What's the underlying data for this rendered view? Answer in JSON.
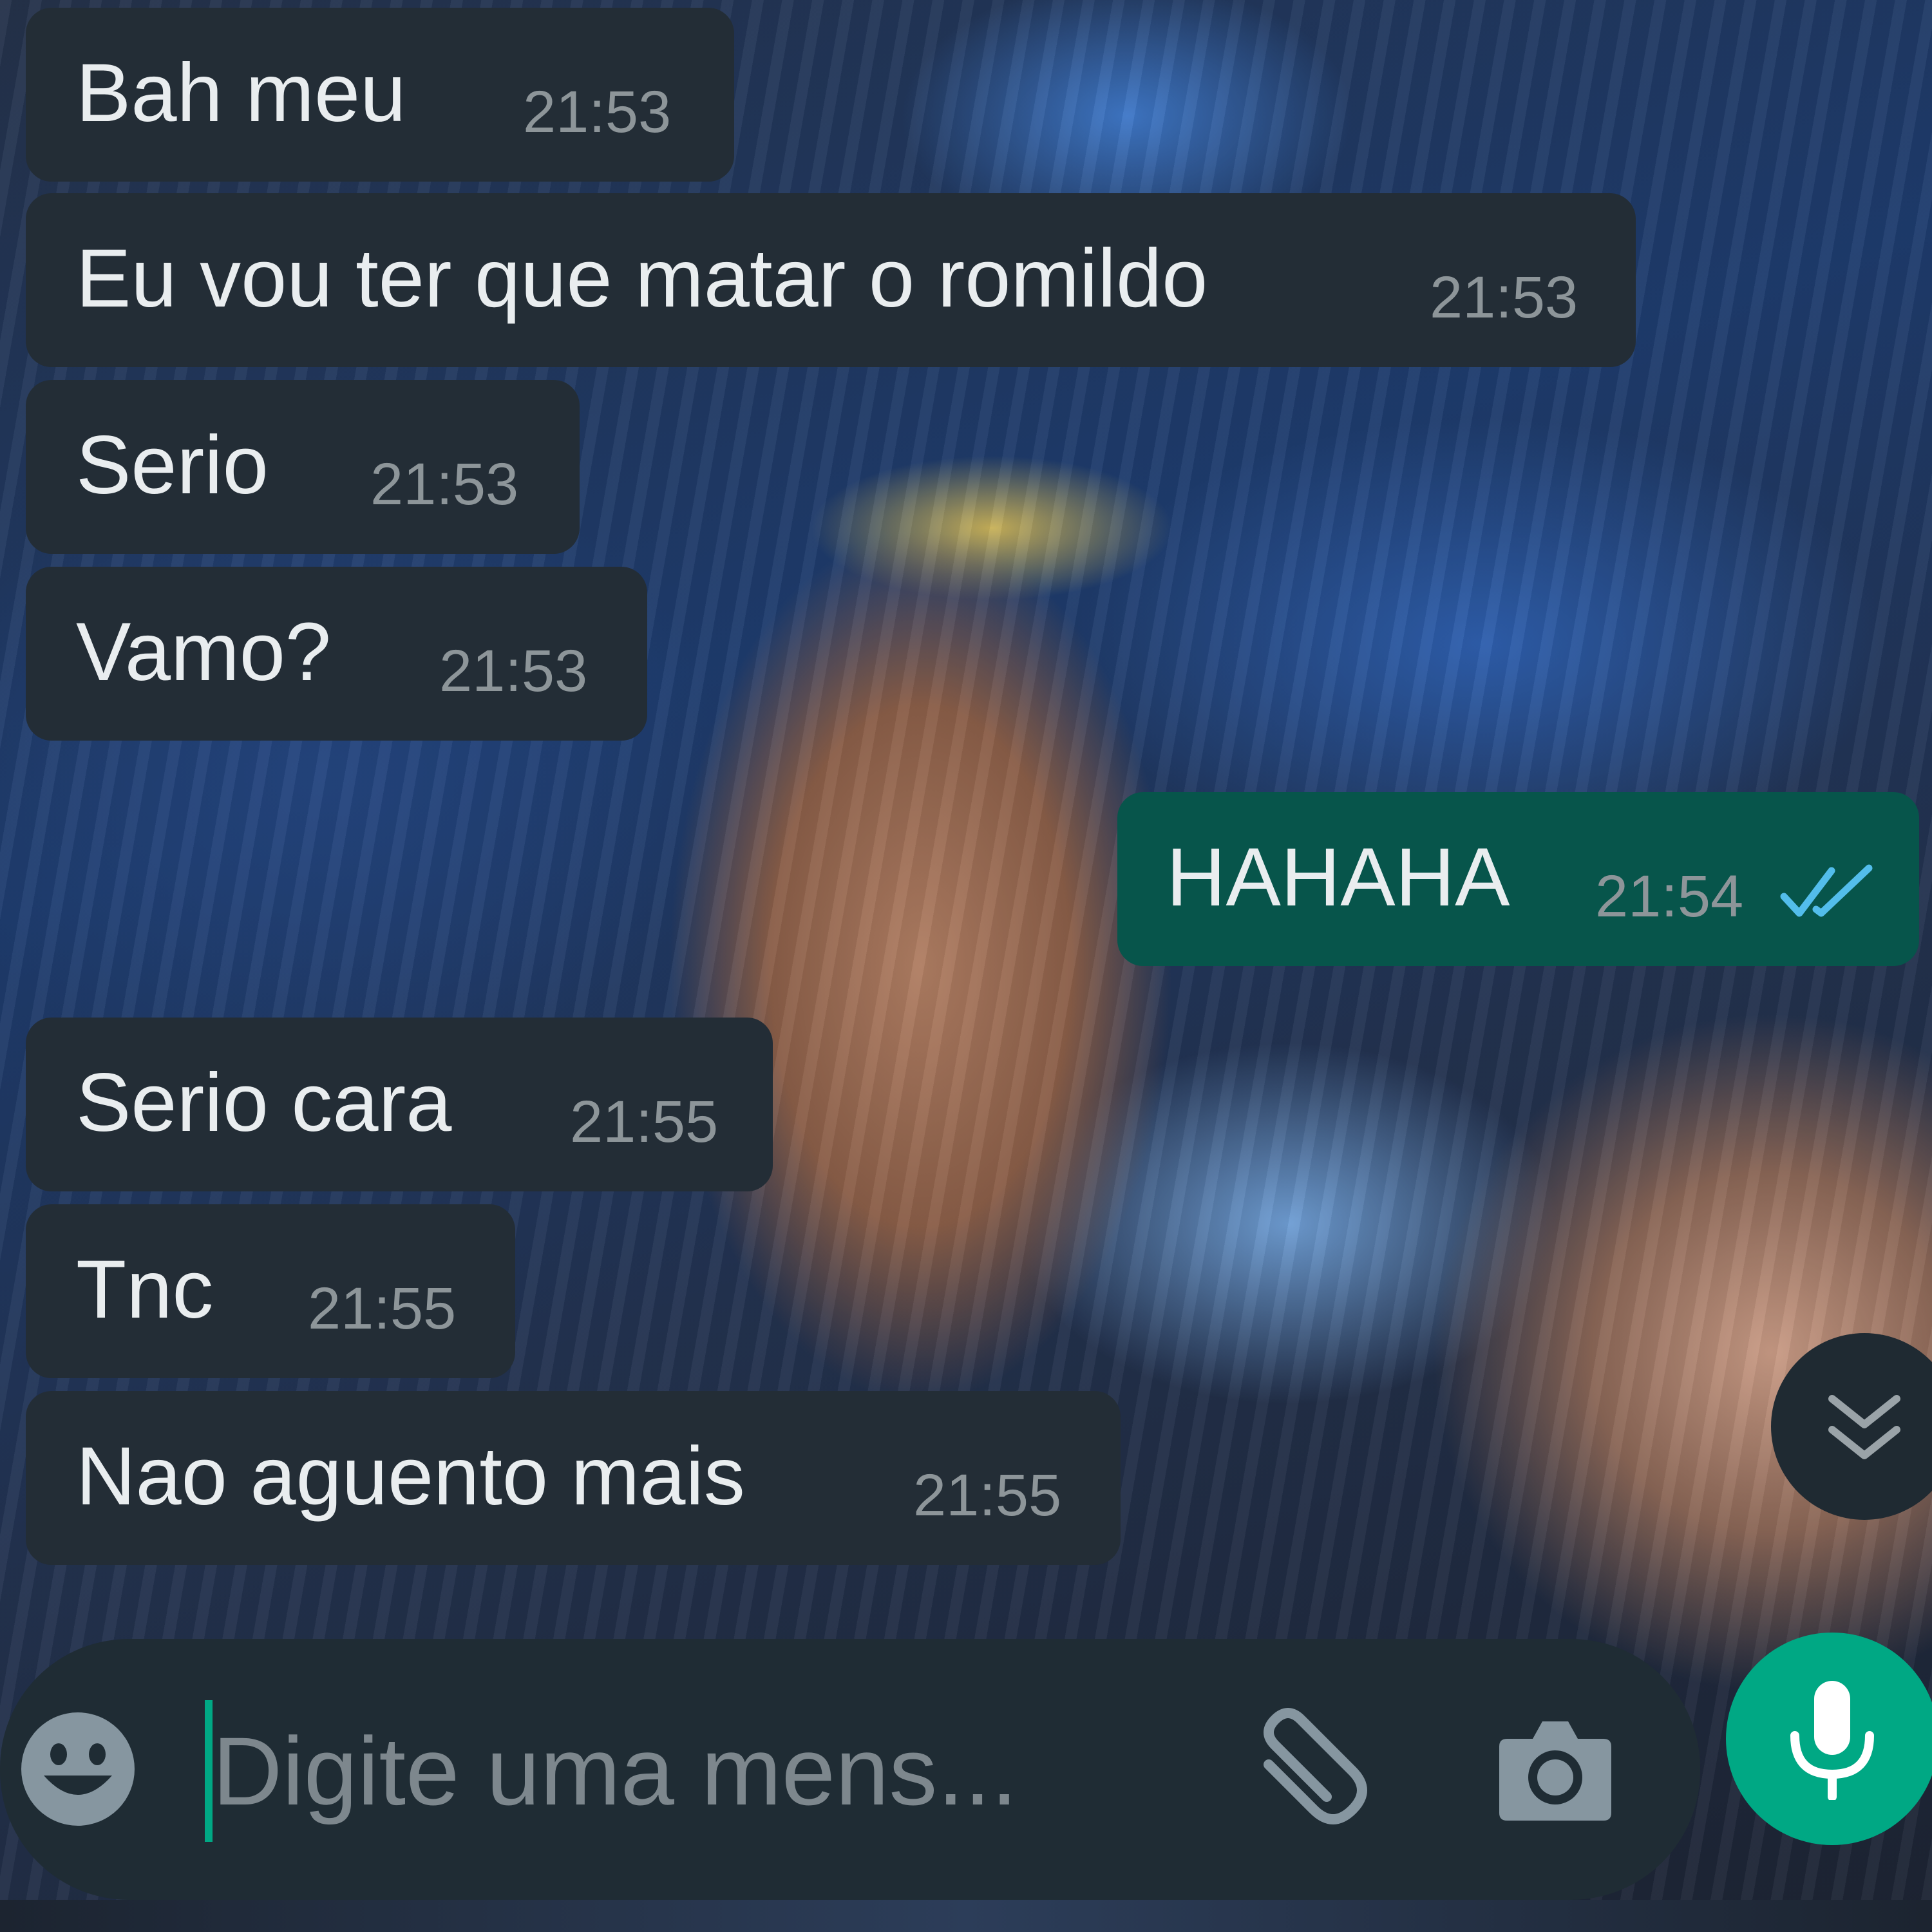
{
  "messages": [
    {
      "text": "Bah meu",
      "time": "21:53",
      "direction": "in"
    },
    {
      "text": "Eu vou ter que matar o romildo",
      "time": "21:53",
      "direction": "in"
    },
    {
      "text": "Serio",
      "time": "21:53",
      "direction": "in"
    },
    {
      "text": "Vamo?",
      "time": "21:53",
      "direction": "in"
    },
    {
      "text": "HAHAHA",
      "time": "21:54",
      "direction": "out",
      "status": "read",
      "status_icon": "double-check-icon"
    },
    {
      "text": "Serio cara",
      "time": "21:55",
      "direction": "in"
    },
    {
      "text": "Tnc",
      "time": "21:55",
      "direction": "in"
    },
    {
      "text": "Nao aguento mais",
      "time": "21:55",
      "direction": "in"
    }
  ],
  "composer": {
    "placeholder": "Digite uma mens...",
    "value": "",
    "emoji_icon": "emoji-icon",
    "attach_icon": "paperclip-icon",
    "camera_icon": "camera-icon"
  },
  "mic_icon": "microphone-icon",
  "scroll_icon": "double-chevron-down-icon",
  "colors": {
    "incoming_bubble": "#232d36",
    "outgoing_bubble": "#07554b",
    "accent": "#00a884",
    "read_ticks": "#53bdeb",
    "text": "#e9edef",
    "timestamp": "#8d9599"
  }
}
